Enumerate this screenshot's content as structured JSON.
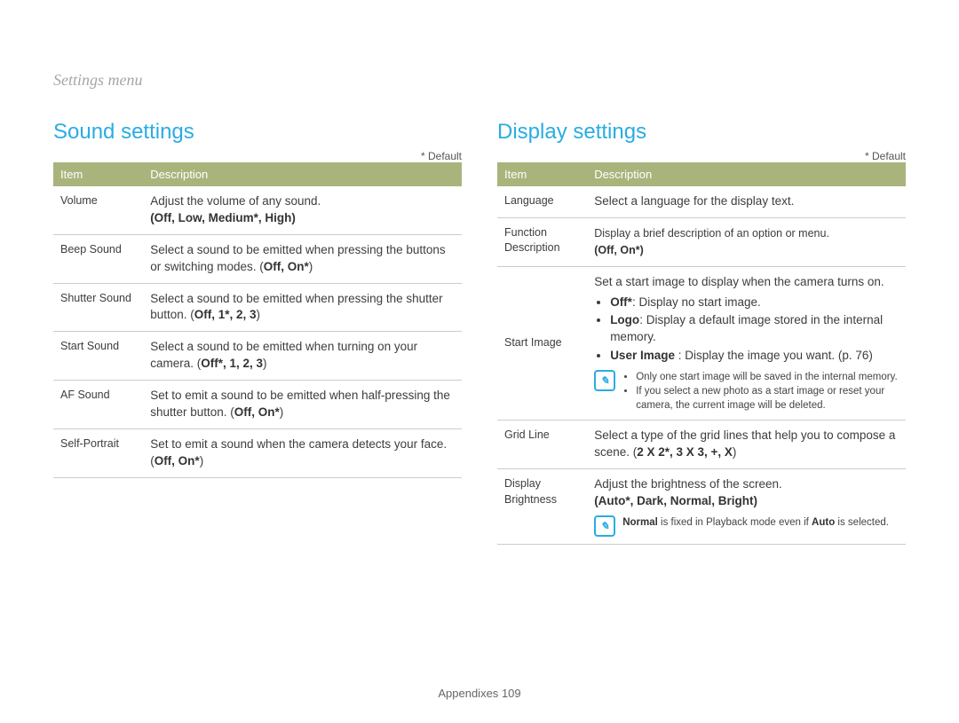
{
  "breadcrumb": "Settings menu",
  "default_note": "* Default",
  "table_headers": {
    "item": "Item",
    "desc": "Description"
  },
  "note_icon_glyph": "✎",
  "sound": {
    "title": "Sound settings",
    "rows": {
      "volume": {
        "item": "Volume",
        "desc": "Adjust the volume of any sound.",
        "options": "(Off, Low, Medium*, High)"
      },
      "beep": {
        "item": "Beep Sound",
        "desc": "Select a sound to be emitted when pressing the buttons or switching modes. (",
        "options": "Off, On*",
        "desc_tail": ")"
      },
      "shutter": {
        "item": "Shutter Sound",
        "desc": "Select a sound to be emitted when pressing the shutter button. (",
        "options": "Off, 1*, 2, 3",
        "desc_tail": ")"
      },
      "start": {
        "item": "Start Sound",
        "desc": "Select a sound to be emitted when turning on your camera. (",
        "options": "Off*, 1, 2, 3",
        "desc_tail": ")"
      },
      "af": {
        "item": "AF Sound",
        "desc": "Set to emit a sound to be emitted when half-pressing the shutter button. (",
        "options": "Off, On*",
        "desc_tail": ")"
      },
      "self": {
        "item": "Self-Portrait",
        "desc": "Set to emit a sound when the camera detects your face. (",
        "options": "Off, On*",
        "desc_tail": ")"
      }
    }
  },
  "display": {
    "title": "Display settings",
    "rows": {
      "language": {
        "item": "Language",
        "desc": "Select a language for the display text."
      },
      "func_desc": {
        "item": "Function Description",
        "desc": "Display a brief description of an option or menu.",
        "options": "(Off, On*)"
      },
      "start_image": {
        "item": "Start Image",
        "desc": "Set a start image to display when the camera turns on.",
        "bullets": {
          "off_lead": "Off*",
          "off_tail": ": Display no start image.",
          "logo_lead": "Logo",
          "logo_tail": ": Display a default image stored in the internal memory.",
          "user_lead": "User Image",
          "user_tail": " : Display the image you want. (p. 76)"
        },
        "notes": {
          "n1": "Only one start image will be saved in the internal memory.",
          "n2": "If you select a new photo as a start image or reset your camera, the current image will be deleted."
        }
      },
      "grid": {
        "item": "Grid Line",
        "desc": "Select a type of the grid lines that help you to compose a scene. (",
        "options": "2 X 2*, 3 X 3, +, X",
        "desc_tail": ")"
      },
      "brightness": {
        "item": "Display Brightness",
        "desc": "Adjust the brightness of the screen.",
        "options": "(Auto*, Dark, Normal, Bright)",
        "note_pre": "Normal",
        "note_mid": " is fixed in Playback mode even if ",
        "note_auto": "Auto",
        "note_tail": " is selected."
      }
    }
  },
  "footer": {
    "label": "Appendixes",
    "page": "109"
  }
}
